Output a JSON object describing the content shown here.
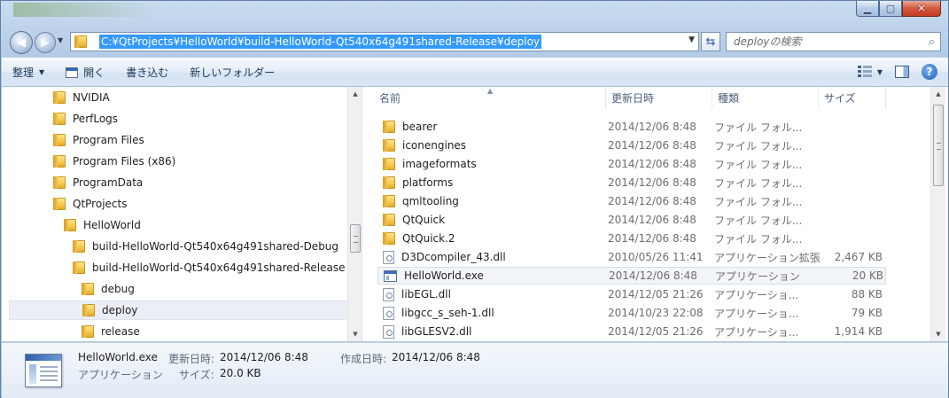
{
  "address": {
    "path": "C:¥QtProjects¥HelloWorld¥build-HelloWorld-Qt540x64g491shared-Release¥deploy"
  },
  "search": {
    "placeholder": "deployの検索"
  },
  "toolbar": {
    "organize": "整理",
    "open": "開く",
    "burn": "書き込む",
    "new_folder": "新しいフォルダー"
  },
  "tree": [
    {
      "label": "NVIDIA",
      "level": 0
    },
    {
      "label": "PerfLogs",
      "level": 0
    },
    {
      "label": "Program Files",
      "level": 0
    },
    {
      "label": "Program Files (x86)",
      "level": 0
    },
    {
      "label": "ProgramData",
      "level": 0
    },
    {
      "label": "QtProjects",
      "level": 0
    },
    {
      "label": "HelloWorld",
      "level": 1
    },
    {
      "label": "build-HelloWorld-Qt540x64g491shared-Debug",
      "level": 2
    },
    {
      "label": "build-HelloWorld-Qt540x64g491shared-Release",
      "level": 2
    },
    {
      "label": "debug",
      "level": 3
    },
    {
      "label": "deploy",
      "level": 3,
      "selected": true
    },
    {
      "label": "release",
      "level": 3
    }
  ],
  "columns": {
    "name": "名前",
    "date": "更新日時",
    "type": "種類",
    "size": "サイズ"
  },
  "files": [
    {
      "name": "bearer",
      "date": "2014/12/06 8:48",
      "type": "ファイル フォル...",
      "size": "",
      "icon": "folder"
    },
    {
      "name": "iconengines",
      "date": "2014/12/06 8:48",
      "type": "ファイル フォル...",
      "size": "",
      "icon": "folder"
    },
    {
      "name": "imageformats",
      "date": "2014/12/06 8:48",
      "type": "ファイル フォル...",
      "size": "",
      "icon": "folder"
    },
    {
      "name": "platforms",
      "date": "2014/12/06 8:48",
      "type": "ファイル フォル...",
      "size": "",
      "icon": "folder"
    },
    {
      "name": "qmltooling",
      "date": "2014/12/06 8:48",
      "type": "ファイル フォル...",
      "size": "",
      "icon": "folder"
    },
    {
      "name": "QtQuick",
      "date": "2014/12/06 8:48",
      "type": "ファイル フォル...",
      "size": "",
      "icon": "folder"
    },
    {
      "name": "QtQuick.2",
      "date": "2014/12/06 8:48",
      "type": "ファイル フォル...",
      "size": "",
      "icon": "folder"
    },
    {
      "name": "D3Dcompiler_43.dll",
      "date": "2010/05/26 11:41",
      "type": "アプリケーション拡張",
      "size": "2,467 KB",
      "icon": "dll"
    },
    {
      "name": "HelloWorld.exe",
      "date": "2014/12/06 8:48",
      "type": "アプリケーション",
      "size": "20 KB",
      "icon": "exe",
      "selected": true
    },
    {
      "name": "libEGL.dll",
      "date": "2014/12/05 21:26",
      "type": "アプリケーショ...",
      "size": "88 KB",
      "icon": "dll"
    },
    {
      "name": "libgcc_s_seh-1.dll",
      "date": "2014/10/23 22:08",
      "type": "アプリケーショ...",
      "size": "79 KB",
      "icon": "dll"
    },
    {
      "name": "libGLESV2.dll",
      "date": "2014/12/05 21:26",
      "type": "アプリケーショ...",
      "size": "1,914 KB",
      "icon": "dll"
    }
  ],
  "details": {
    "filename": "HelloWorld.exe",
    "modified_label": "更新日時:",
    "modified_value": "2014/12/06 8:48",
    "created_label": "作成日時:",
    "created_value": "2014/12/06 8:48",
    "type": "アプリケーション",
    "size_label": "サイズ:",
    "size_value": "20.0 KB"
  }
}
